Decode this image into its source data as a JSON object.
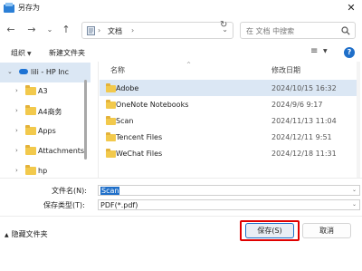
{
  "window": {
    "title": "另存为"
  },
  "navigation": {
    "breadcrumb": "文档",
    "search_placeholder": "在 文档 中搜索"
  },
  "toolbar": {
    "organize_label": "组织",
    "new_folder_label": "新建文件夹"
  },
  "sidebar": {
    "items": [
      {
        "label": "lili - HP Inc",
        "type": "cloud",
        "expanded": true,
        "selected": true
      },
      {
        "label": "A3",
        "type": "folder"
      },
      {
        "label": "A4商务",
        "type": "folder"
      },
      {
        "label": "Apps",
        "type": "folder"
      },
      {
        "label": "Attachments",
        "type": "folder"
      },
      {
        "label": "hp",
        "type": "folder"
      }
    ]
  },
  "file_list": {
    "columns": {
      "name": "名称",
      "modified": "修改日期"
    },
    "rows": [
      {
        "name": "Adobe",
        "modified": "2024/10/15 16:32",
        "selected": true
      },
      {
        "name": "OneNote Notebooks",
        "modified": "2024/9/6 9:17"
      },
      {
        "name": "Scan",
        "modified": "2024/11/13 11:04"
      },
      {
        "name": "Tencent Files",
        "modified": "2024/12/11 9:51"
      },
      {
        "name": "WeChat Files",
        "modified": "2024/12/18 11:31"
      }
    ]
  },
  "form": {
    "filename_label": "文件名(N):",
    "filename_value": "Scan",
    "filetype_label": "保存类型(T):",
    "filetype_value": "PDF(*.pdf)"
  },
  "footer": {
    "hide_folders_label": "隐藏文件夹",
    "save_label": "保存(S)",
    "cancel_label": "取消"
  },
  "colors": {
    "accent": "#1f6fc9",
    "selection": "#dbe7f4",
    "folder": "#f2c94c",
    "highlight_box": "#e00000"
  }
}
